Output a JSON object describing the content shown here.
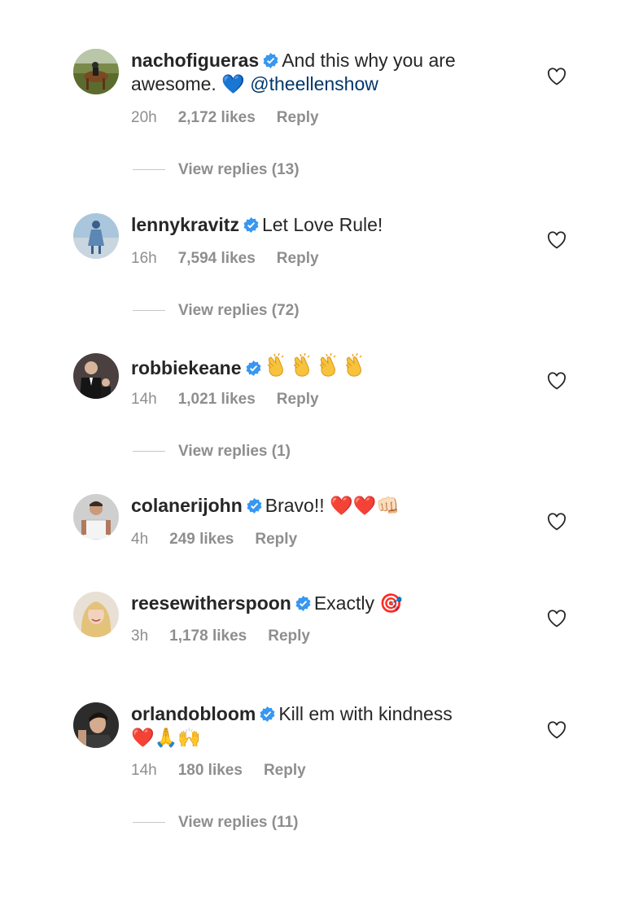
{
  "colors": {
    "verified": "#3897f0",
    "mention": "#00376b",
    "muted": "#8e8e8e"
  },
  "comments": [
    {
      "username": "nachofigueras",
      "text": "And this why you are",
      "text_line2": "awesome.",
      "emoji": "💙",
      "mention": "@theellenshow",
      "time": "20h",
      "likes": "2,172 likes",
      "reply": "Reply",
      "view_replies": "View replies (13)"
    },
    {
      "username": "lennykravitz",
      "text": "Let Love Rule!",
      "time": "16h",
      "likes": "7,594 likes",
      "reply": "Reply",
      "view_replies": "View replies (72)"
    },
    {
      "username": "robbiekeane",
      "emoji_desc": "clapping-hands-icon x4",
      "time": "14h",
      "likes": "1,021 likes",
      "reply": "Reply",
      "view_replies": "View replies (1)"
    },
    {
      "username": "colanerijohn",
      "text": "Bravo!!",
      "emoji": "❤️❤️👊🏻",
      "time": "4h",
      "likes": "249 likes",
      "reply": "Reply"
    },
    {
      "username": "reesewitherspoon",
      "text": "Exactly",
      "emoji": "🎯",
      "time": "3h",
      "likes": "1,178 likes",
      "reply": "Reply"
    },
    {
      "username": "orlandobloom",
      "text": "Kill em with kindness",
      "emoji": "❤️🙏🙌",
      "time": "14h",
      "likes": "180 likes",
      "reply": "Reply",
      "view_replies": "View replies (11)"
    }
  ]
}
